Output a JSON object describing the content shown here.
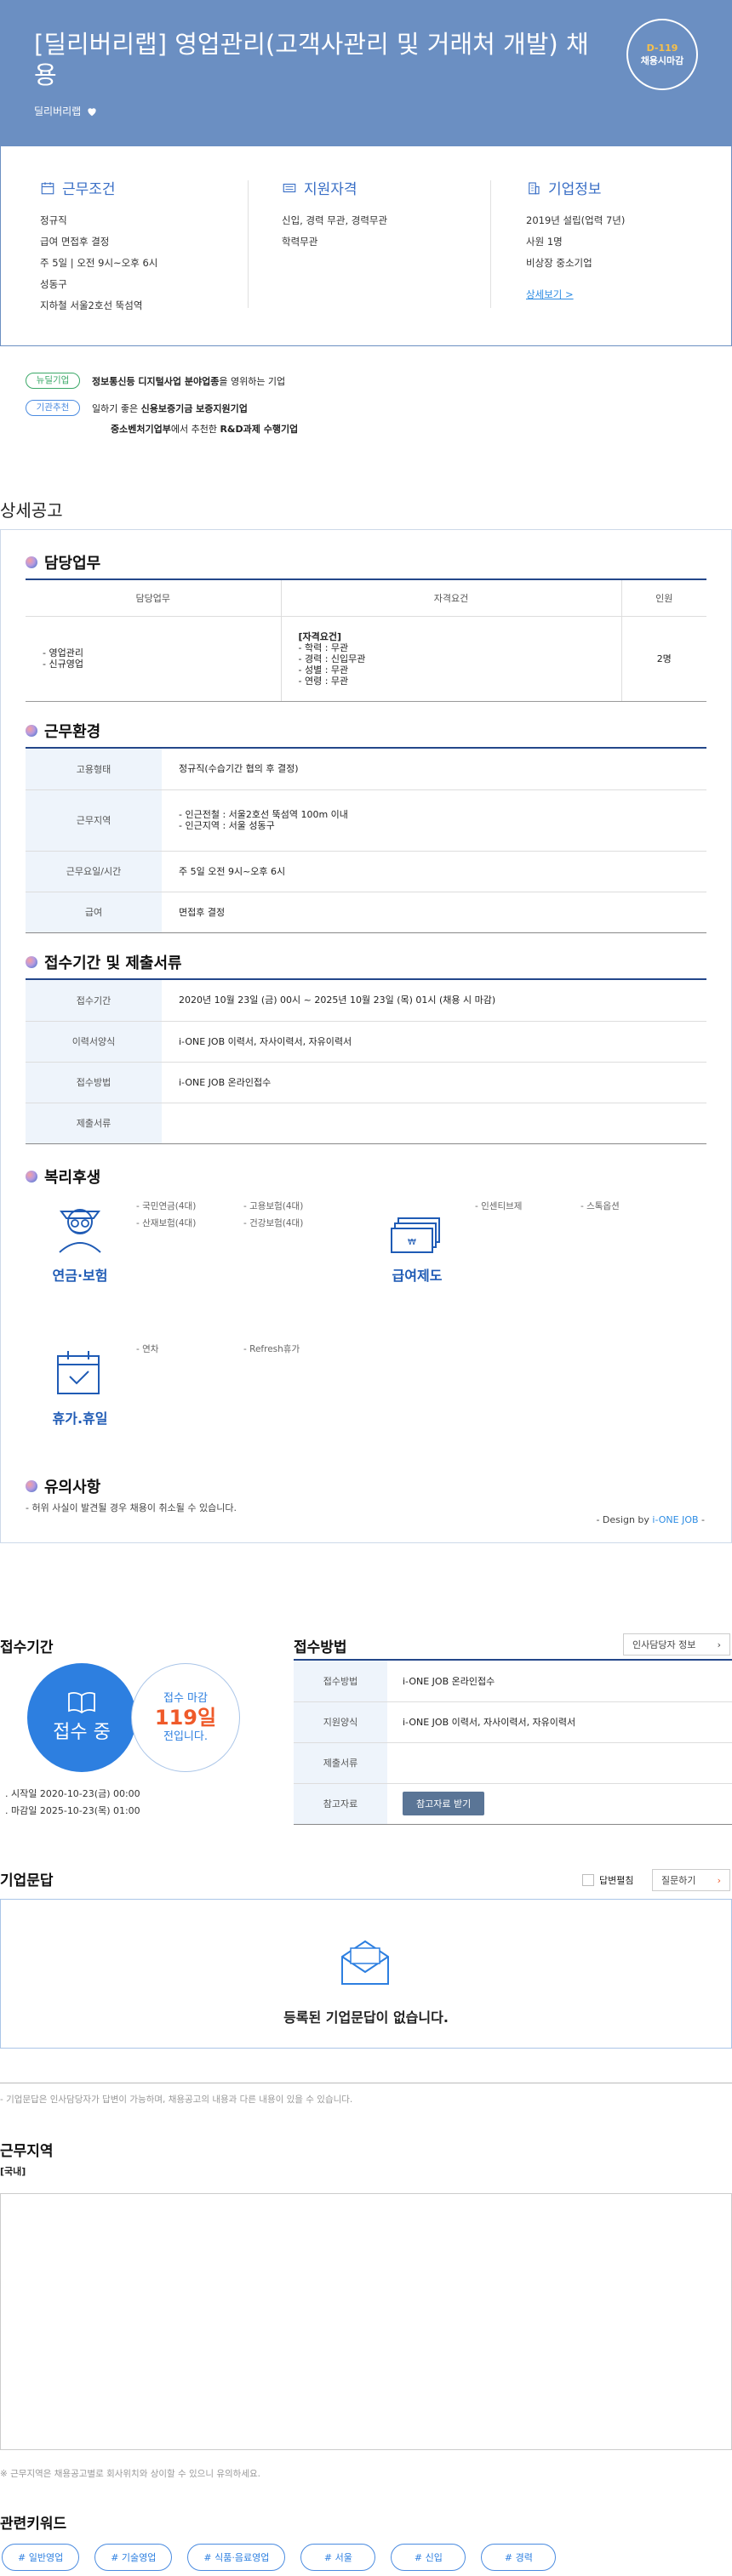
{
  "hero": {
    "title": "[딜리버리랩] 영업관리(고객사관리 및 거래처 개발) 채용",
    "company": "딜리버리랩",
    "dday": "D-119",
    "dday_status": "채용시마감"
  },
  "summary": {
    "conditions": {
      "title": "근무조건",
      "items": [
        "정규직",
        "급여 면접후 결정",
        "주 5일 | 오전 9시~오후 6시",
        "성동구",
        "지하철 서울2호선 뚝섬역"
      ]
    },
    "qualifications": {
      "title": "지원자격",
      "items": [
        "신입, 경력 무관, 경력무관",
        "학력무관"
      ]
    },
    "company": {
      "title": "기업정보",
      "items": [
        "2019년 설립(업력 7년)",
        "사원 1명",
        "비상장 중소기업"
      ],
      "link": "상세보기 >"
    }
  },
  "tags": [
    {
      "pill": "뉴딜기업",
      "text_bold": "정보통신등 디지털사업 분야업종",
      "text": "을 영위하는 기업"
    },
    {
      "pill": "기관추천",
      "text": "일하기 좋은 ",
      "text_bold": "신용보증기금 보증지원기업"
    },
    {
      "text_bold": "중소벤처기업부",
      "text": "에서 추천한 ",
      "text_bold2": "R&D과제 수행기업"
    }
  ],
  "detail": {
    "section_title": "상세공고",
    "duty": {
      "title": "담당업무",
      "headers": [
        "담당업무",
        "자격요건",
        "인원"
      ],
      "duties": [
        "- 영업관리",
        "- 신규영업"
      ],
      "req_title": "[자격요건]",
      "requirements": [
        "- 학력 : 무관",
        "- 경력 : 신입무관",
        "- 성별 : 무관",
        "- 연령 : 무관"
      ],
      "headcount": "2명"
    },
    "env": {
      "title": "근무환경",
      "rows": [
        {
          "k": "고용형태",
          "v": "정규직(수습기간 협의 후 결정)"
        },
        {
          "k": "근무지역",
          "v1": "- 인근전철 : 서울2호선 뚝섬역 100m 이내",
          "v2": "- 인근지역 : 서울 성동구"
        },
        {
          "k": "근무요일/시간",
          "v": "주 5일 오전 9시~오후 6시"
        },
        {
          "k": "급여",
          "v": "면접후 결정"
        }
      ]
    },
    "period": {
      "title": "접수기간 및 제출서류",
      "rows": [
        {
          "k": "접수기간",
          "v": "2020년 10월 23일 (금) 00시 ~ 2025년 10월 23일 (목) 01시 (채용 시 마감)"
        },
        {
          "k": "이력서양식",
          "v": "i-ONE JOB 이력서, 자사이력서, 자유이력서"
        },
        {
          "k": "접수방법",
          "v": "i-ONE JOB 온라인접수"
        },
        {
          "k": "제출서류",
          "v": ""
        }
      ]
    },
    "welfare": {
      "title": "복리후생",
      "insurance": {
        "label": "연금·보험",
        "items": [
          "- 국민연금(4대)",
          "- 고용보험(4대)",
          "- 산재보험(4대)",
          "- 건강보험(4대)"
        ]
      },
      "salary": {
        "label": "급여제도",
        "items": [
          "- 인센티브제",
          "- 스톡옵션"
        ]
      },
      "vacation": {
        "label": "휴가.휴일",
        "items": [
          "- 연차",
          "- Refresh휴가"
        ]
      }
    },
    "notice": {
      "title": "유의사항",
      "text": "- 허위 사실이 발견될 경우 채용이 취소될 수 있습니다.",
      "design_prefix": "- Design by ",
      "design_brand": "i-ONE JOB",
      "design_suffix": " -"
    }
  },
  "apply": {
    "period_title": "접수기간",
    "status": "접수 중",
    "until_label": "접수 마감",
    "days": "119일",
    "days_suffix": "전입니다.",
    "start": ". 시작일 2020-10-23(금) 00:00",
    "end": ". 마감일 2025-10-23(목) 01:00",
    "method_title": "접수방법",
    "hr_button": "인사담당자 정보",
    "rows": [
      {
        "k": "접수방법",
        "v": "i-ONE JOB 온라인접수"
      },
      {
        "k": "지원양식",
        "v": "i-ONE JOB 이력서, 자사이력서, 자유이력서"
      },
      {
        "k": "제출서류",
        "v": ""
      },
      {
        "k": "참고자료",
        "btn": "참고자료 받기"
      }
    ]
  },
  "qa": {
    "title": "기업문답",
    "checkbox_label": "답변펼침",
    "ask_button": "질문하기",
    "empty": "등록된 기업문답이 없습니다.",
    "note": "- 기업문답은 인사담당자가 답변이 가능하며, 채용공고의 내용과 다른 내용이 있을 수 있습니다."
  },
  "location": {
    "title": "근무지역",
    "subtitle": "[국내]",
    "note": "※ 근무지역은 채용공고별로 회사위치와 상이할 수 있으니 유의하세요."
  },
  "keywords": {
    "title": "관련키워드",
    "items": [
      "# 일반영업",
      "# 기술영업",
      "# 식품·음료영업",
      "# 서울",
      "# 신입",
      "# 경력"
    ]
  },
  "colors": {
    "hero": "#6b8fc2",
    "accent": "#2d7fe0",
    "navy": "#24478a",
    "dday": "#f7c04a",
    "days": "#ef5a2a"
  }
}
